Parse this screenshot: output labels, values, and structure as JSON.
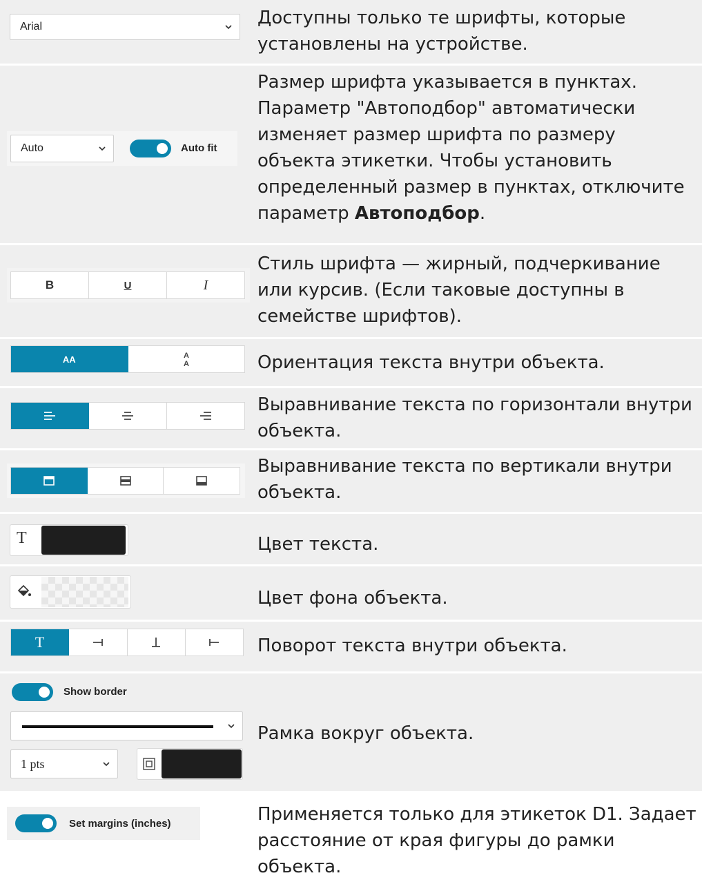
{
  "rows": [
    {
      "widget": {
        "font_select": {
          "value": "Arial"
        }
      },
      "description": "Доступны только те шрифты, которые установлены на устройстве."
    },
    {
      "widget": {
        "size_select": {
          "value": "Auto"
        },
        "autofit_toggle": {
          "label": "Auto fit",
          "on": true
        }
      },
      "description_prefix": "Размер шрифта указывается в пунктах. Параметр \"Автоподбор\" автоматически изменяет размер шрифта по размеру объекта этикетки. Чтобы установить определенный размер в пунктах, отключите параметр ",
      "description_bold": "Автоподбор",
      "description_suffix": "."
    },
    {
      "widget": {
        "style_buttons": [
          "B",
          "U",
          "I"
        ]
      },
      "description": "Стиль шрифта — жирный, подчеркивание или курсив. (Если таковые доступны в семействе шрифтов)."
    },
    {
      "widget": {
        "orientation_buttons": [
          "AA",
          "A A"
        ],
        "active_index": 0
      },
      "description": "Ориентация текста внутри объекта."
    },
    {
      "widget": {
        "halign_icons": [
          "align-left-icon",
          "align-center-icon",
          "align-right-icon"
        ],
        "active_index": 0
      },
      "description": "Выравнивание текста по горизонтали внутри объекта."
    },
    {
      "widget": {
        "valign_icons": [
          "align-top-icon",
          "align-middle-icon",
          "align-bottom-icon"
        ],
        "active_index": 0
      },
      "description": "Выравнивание текста по вертикали внутри объекта."
    },
    {
      "widget": {
        "text_color": {
          "icon_letter": "T",
          "color": "#1e1e1e"
        }
      },
      "description": "Цвет текста."
    },
    {
      "widget": {
        "fill_color": {
          "icon": "paint-bucket-icon",
          "color": "transparent"
        }
      },
      "description": "Цвет фона объекта."
    },
    {
      "widget": {
        "rotation_icons": [
          "rotate-0-icon",
          "rotate-90-icon",
          "rotate-180-icon",
          "rotate-270-icon"
        ],
        "active_index": 0,
        "first_letter": "T"
      },
      "description": "Поворот текста внутри объекта."
    },
    {
      "widget": {
        "border_toggle": {
          "label": "Show border",
          "on": true
        },
        "line_style_select": {
          "value": "solid"
        },
        "thickness_select": {
          "value": "1 pts"
        },
        "border_color": "#1e1e1e"
      },
      "description": "Рамка вокруг объекта."
    },
    {
      "widget": {
        "margins_toggle": {
          "label": "Set margins (inches)",
          "on": true
        }
      },
      "description": "Применяется только для этикеток D1. Задает расстояние от края фигуры до рамки объекта."
    }
  ],
  "colors": {
    "accent": "#0a85ad",
    "row_shade": "#efefef",
    "swatch_black": "#1e1e1e"
  }
}
